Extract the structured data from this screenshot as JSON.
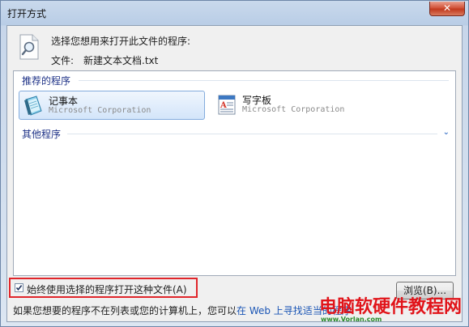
{
  "window": {
    "title": "打开方式",
    "close_glyph": "✕"
  },
  "header": {
    "prompt": "选择您想用来打开此文件的程序:",
    "file_label": "文件:",
    "file_name": "新建文本文档.txt"
  },
  "recommended": {
    "title": "推荐的程序",
    "programs": [
      {
        "name": "记事本",
        "vendor": "Microsoft Corporation",
        "icon": "notepad-icon",
        "selected": true
      },
      {
        "name": "写字板",
        "vendor": "Microsoft Corporation",
        "icon": "wordpad-icon",
        "selected": false
      }
    ]
  },
  "other": {
    "title": "其他程序",
    "chevron_icon": "chevron-down-icon",
    "chevron_glyph": "⌄"
  },
  "always_use": {
    "label": "始终使用选择的程序打开这种文件(A)",
    "checked": true
  },
  "browse_button": "浏览(B)...",
  "hint": {
    "text": "如果您想要的程序不在列表或您的计算机上，您可以",
    "link_prefix": "在 Web 上寻找",
    "link_rest": "适当的程序"
  },
  "watermark": {
    "text": "电脑软硬件教程网",
    "sub": "www.Vorlan.com"
  },
  "colors": {
    "highlight_border": "#e0262b",
    "link": "#1a55b5",
    "group_header": "#1e3287",
    "selection_border": "#84acdd"
  }
}
